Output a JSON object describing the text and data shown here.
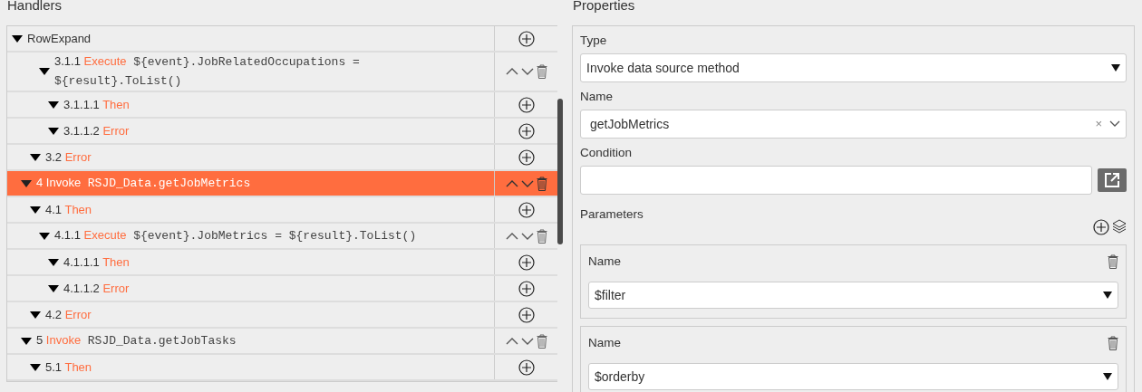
{
  "handlers": {
    "title": "Handlers",
    "root": {
      "label": "RowExpand",
      "expanded": true,
      "kind": "add",
      "children": [
        {
          "children": [
            {
              "children": [
                {
                  "number": "3.1.1",
                  "verb": "Execute",
                  "code": "${event}.JobRelatedOccupations = ${result}.ToList()",
                  "expanded": true,
                  "selected": false,
                  "kind": "move",
                  "children": [
                    {
                      "number": "3.1.1.1",
                      "verb": "Then",
                      "expanded": true,
                      "selected": false,
                      "kind": "add"
                    },
                    {
                      "number": "3.1.1.2",
                      "verb": "Error",
                      "expanded": true,
                      "selected": false,
                      "kind": "add"
                    }
                  ]
                }
              ]
            },
            {
              "number": "3.2",
              "verb": "Error",
              "expanded": true,
              "selected": false,
              "kind": "add"
            }
          ]
        },
        {
          "number": "4",
          "verb": "Invoke",
          "code": "RSJD_Data.getJobMetrics",
          "expanded": true,
          "selected": true,
          "kind": "move",
          "children": [
            {
              "number": "4.1",
              "verb": "Then",
              "expanded": true,
              "selected": false,
              "kind": "add",
              "children": [
                {
                  "number": "4.1.1",
                  "verb": "Execute",
                  "code": "${event}.JobMetrics = ${result}.ToList()",
                  "expanded": true,
                  "selected": false,
                  "kind": "move",
                  "children": [
                    {
                      "number": "4.1.1.1",
                      "verb": "Then",
                      "expanded": true,
                      "selected": false,
                      "kind": "add"
                    },
                    {
                      "number": "4.1.1.2",
                      "verb": "Error",
                      "expanded": true,
                      "selected": false,
                      "kind": "add"
                    }
                  ]
                }
              ]
            },
            {
              "number": "4.2",
              "verb": "Error",
              "expanded": true,
              "selected": false,
              "kind": "add"
            }
          ]
        },
        {
          "number": "5",
          "verb": "Invoke",
          "code": "RSJD_Data.getJobTasks",
          "expanded": true,
          "selected": false,
          "kind": "move",
          "children": [
            {
              "number": "5.1",
              "verb": "Then",
              "expanded": true,
              "selected": false,
              "kind": "add"
            }
          ]
        }
      ]
    }
  },
  "properties": {
    "title": "Properties",
    "type": {
      "label": "Type",
      "value": "Invoke data source method"
    },
    "name": {
      "label": "Name",
      "value": "getJobMetrics",
      "clear": "×"
    },
    "condition": {
      "label": "Condition"
    },
    "parameters": {
      "label": "Parameters",
      "items": [
        {
          "label": "Name",
          "value": "$filter"
        },
        {
          "label": "Name",
          "value": "$orderby"
        }
      ]
    }
  }
}
